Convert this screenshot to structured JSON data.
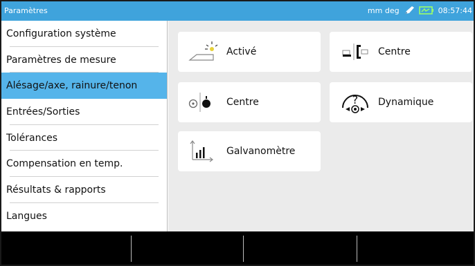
{
  "statusbar": {
    "title": "Paramètres",
    "units": "mm deg",
    "time": "08:57:44",
    "icons": [
      "pen-icon",
      "battery-icon"
    ]
  },
  "sidebar": {
    "items": [
      {
        "label": "Configuration système"
      },
      {
        "label": "Paramètres de mesure"
      },
      {
        "label": "Alésage/axe, rainure/tenon"
      },
      {
        "label": "Entrées/Sorties"
      },
      {
        "label": "Tolérances"
      },
      {
        "label": "Compensation en temp."
      },
      {
        "label": "Résultats & rapports"
      },
      {
        "label": "Langues"
      }
    ],
    "active_index": 2
  },
  "tiles": [
    {
      "label": "Activé",
      "icon": "probe-light-icon"
    },
    {
      "label": "Centre",
      "icon": "center-bracket-icon"
    },
    {
      "label": "Centre",
      "icon": "center-point-icon"
    },
    {
      "label": "Dynamique",
      "icon": "dynamic-help-icon"
    },
    {
      "label": "Galvanomètre",
      "icon": "galvanometer-icon"
    }
  ],
  "softkeys": [
    "",
    "",
    "",
    ""
  ],
  "colors": {
    "accent": "#3fa3dc",
    "active_item": "#55b4ea",
    "content_bg": "#ebebeb",
    "bottom_bar": "#000000"
  }
}
